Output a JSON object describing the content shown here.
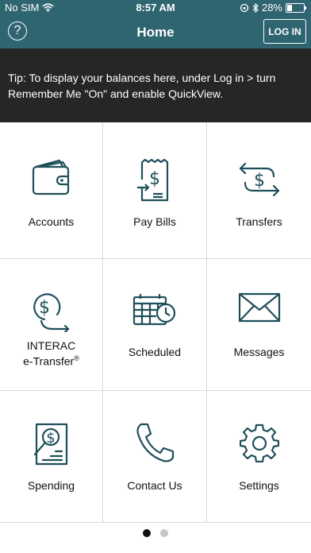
{
  "status": {
    "carrier": "No SIM",
    "time": "8:57 AM",
    "battery": "28%",
    "battery_level": 0.28
  },
  "header": {
    "title": "Home",
    "login_label": "LOG IN",
    "help_symbol": "?"
  },
  "tip": {
    "text": "Tip: To display your balances here, under Log in > turn Remember Me \"On\" and enable QuickView."
  },
  "tiles": [
    {
      "label": "Accounts",
      "icon": "wallet-icon"
    },
    {
      "label": "Pay Bills",
      "icon": "bill-icon"
    },
    {
      "label": "Transfers",
      "icon": "transfer-icon"
    },
    {
      "label_line1": "INTERAC",
      "label_line2": "e-Transfer",
      "label_sup": "®",
      "icon": "etransfer-icon"
    },
    {
      "label": "Scheduled",
      "icon": "calendar-clock-icon"
    },
    {
      "label": "Messages",
      "icon": "envelope-icon"
    },
    {
      "label": "Spending",
      "icon": "spending-icon"
    },
    {
      "label": "Contact Us",
      "icon": "phone-icon"
    },
    {
      "label": "Settings",
      "icon": "gear-icon"
    }
  ],
  "pager": {
    "pages": 2,
    "current": 1
  },
  "colors": {
    "header": "#2f6471",
    "tip_bg": "#262626",
    "icon": "#1f4f5a"
  }
}
